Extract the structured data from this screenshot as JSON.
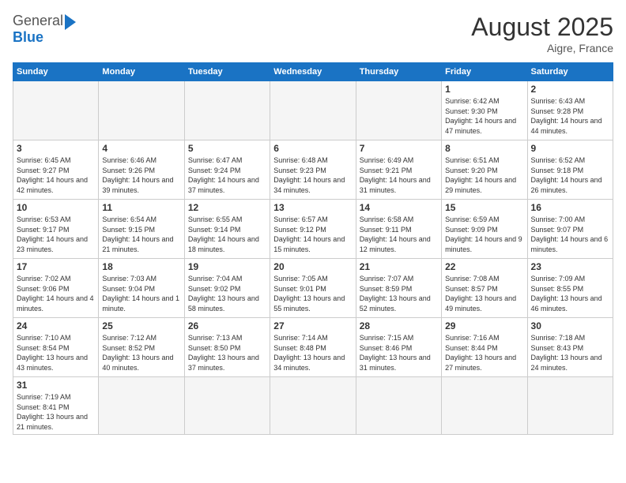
{
  "header": {
    "logo_general": "General",
    "logo_blue": "Blue",
    "month_year": "August 2025",
    "location": "Aigre, France"
  },
  "days_of_week": [
    "Sunday",
    "Monday",
    "Tuesday",
    "Wednesday",
    "Thursday",
    "Friday",
    "Saturday"
  ],
  "weeks": [
    [
      {
        "day": "",
        "info": ""
      },
      {
        "day": "",
        "info": ""
      },
      {
        "day": "",
        "info": ""
      },
      {
        "day": "",
        "info": ""
      },
      {
        "day": "",
        "info": ""
      },
      {
        "day": "1",
        "info": "Sunrise: 6:42 AM\nSunset: 9:30 PM\nDaylight: 14 hours and 47 minutes."
      },
      {
        "day": "2",
        "info": "Sunrise: 6:43 AM\nSunset: 9:28 PM\nDaylight: 14 hours and 44 minutes."
      }
    ],
    [
      {
        "day": "3",
        "info": "Sunrise: 6:45 AM\nSunset: 9:27 PM\nDaylight: 14 hours and 42 minutes."
      },
      {
        "day": "4",
        "info": "Sunrise: 6:46 AM\nSunset: 9:26 PM\nDaylight: 14 hours and 39 minutes."
      },
      {
        "day": "5",
        "info": "Sunrise: 6:47 AM\nSunset: 9:24 PM\nDaylight: 14 hours and 37 minutes."
      },
      {
        "day": "6",
        "info": "Sunrise: 6:48 AM\nSunset: 9:23 PM\nDaylight: 14 hours and 34 minutes."
      },
      {
        "day": "7",
        "info": "Sunrise: 6:49 AM\nSunset: 9:21 PM\nDaylight: 14 hours and 31 minutes."
      },
      {
        "day": "8",
        "info": "Sunrise: 6:51 AM\nSunset: 9:20 PM\nDaylight: 14 hours and 29 minutes."
      },
      {
        "day": "9",
        "info": "Sunrise: 6:52 AM\nSunset: 9:18 PM\nDaylight: 14 hours and 26 minutes."
      }
    ],
    [
      {
        "day": "10",
        "info": "Sunrise: 6:53 AM\nSunset: 9:17 PM\nDaylight: 14 hours and 23 minutes."
      },
      {
        "day": "11",
        "info": "Sunrise: 6:54 AM\nSunset: 9:15 PM\nDaylight: 14 hours and 21 minutes."
      },
      {
        "day": "12",
        "info": "Sunrise: 6:55 AM\nSunset: 9:14 PM\nDaylight: 14 hours and 18 minutes."
      },
      {
        "day": "13",
        "info": "Sunrise: 6:57 AM\nSunset: 9:12 PM\nDaylight: 14 hours and 15 minutes."
      },
      {
        "day": "14",
        "info": "Sunrise: 6:58 AM\nSunset: 9:11 PM\nDaylight: 14 hours and 12 minutes."
      },
      {
        "day": "15",
        "info": "Sunrise: 6:59 AM\nSunset: 9:09 PM\nDaylight: 14 hours and 9 minutes."
      },
      {
        "day": "16",
        "info": "Sunrise: 7:00 AM\nSunset: 9:07 PM\nDaylight: 14 hours and 6 minutes."
      }
    ],
    [
      {
        "day": "17",
        "info": "Sunrise: 7:02 AM\nSunset: 9:06 PM\nDaylight: 14 hours and 4 minutes."
      },
      {
        "day": "18",
        "info": "Sunrise: 7:03 AM\nSunset: 9:04 PM\nDaylight: 14 hours and 1 minute."
      },
      {
        "day": "19",
        "info": "Sunrise: 7:04 AM\nSunset: 9:02 PM\nDaylight: 13 hours and 58 minutes."
      },
      {
        "day": "20",
        "info": "Sunrise: 7:05 AM\nSunset: 9:01 PM\nDaylight: 13 hours and 55 minutes."
      },
      {
        "day": "21",
        "info": "Sunrise: 7:07 AM\nSunset: 8:59 PM\nDaylight: 13 hours and 52 minutes."
      },
      {
        "day": "22",
        "info": "Sunrise: 7:08 AM\nSunset: 8:57 PM\nDaylight: 13 hours and 49 minutes."
      },
      {
        "day": "23",
        "info": "Sunrise: 7:09 AM\nSunset: 8:55 PM\nDaylight: 13 hours and 46 minutes."
      }
    ],
    [
      {
        "day": "24",
        "info": "Sunrise: 7:10 AM\nSunset: 8:54 PM\nDaylight: 13 hours and 43 minutes."
      },
      {
        "day": "25",
        "info": "Sunrise: 7:12 AM\nSunset: 8:52 PM\nDaylight: 13 hours and 40 minutes."
      },
      {
        "day": "26",
        "info": "Sunrise: 7:13 AM\nSunset: 8:50 PM\nDaylight: 13 hours and 37 minutes."
      },
      {
        "day": "27",
        "info": "Sunrise: 7:14 AM\nSunset: 8:48 PM\nDaylight: 13 hours and 34 minutes."
      },
      {
        "day": "28",
        "info": "Sunrise: 7:15 AM\nSunset: 8:46 PM\nDaylight: 13 hours and 31 minutes."
      },
      {
        "day": "29",
        "info": "Sunrise: 7:16 AM\nSunset: 8:44 PM\nDaylight: 13 hours and 27 minutes."
      },
      {
        "day": "30",
        "info": "Sunrise: 7:18 AM\nSunset: 8:43 PM\nDaylight: 13 hours and 24 minutes."
      }
    ],
    [
      {
        "day": "31",
        "info": "Sunrise: 7:19 AM\nSunset: 8:41 PM\nDaylight: 13 hours and 21 minutes."
      },
      {
        "day": "",
        "info": ""
      },
      {
        "day": "",
        "info": ""
      },
      {
        "day": "",
        "info": ""
      },
      {
        "day": "",
        "info": ""
      },
      {
        "day": "",
        "info": ""
      },
      {
        "day": "",
        "info": ""
      }
    ]
  ]
}
